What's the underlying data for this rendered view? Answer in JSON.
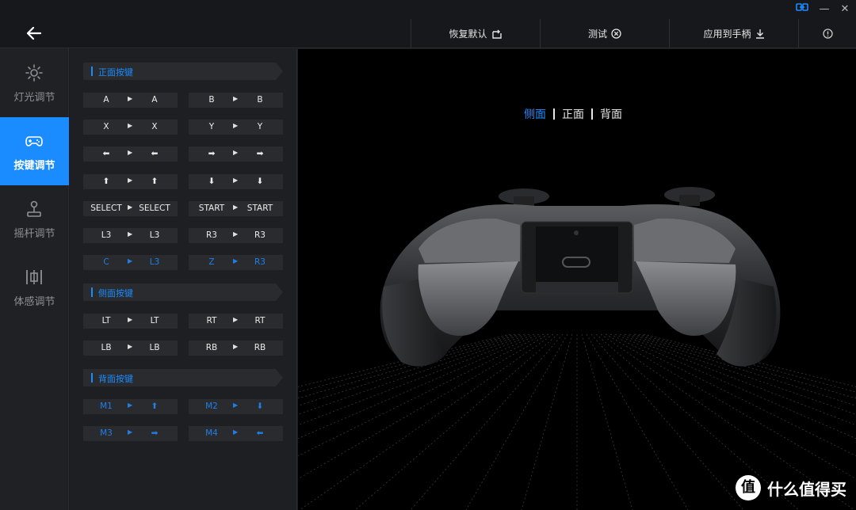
{
  "window": {
    "link_icon": "link-icon",
    "minimize": "—",
    "close": "✕"
  },
  "nav": {
    "back_icon": "arrow-left-icon",
    "items": [
      {
        "label": "灯光调节",
        "icon": "sun-icon",
        "active": false
      },
      {
        "label": "按键调节",
        "icon": "gamepad-icon",
        "active": true
      },
      {
        "label": "摇杆调节",
        "icon": "joystick-icon",
        "active": false
      },
      {
        "label": "体感调节",
        "icon": "motion-icon",
        "active": false
      }
    ]
  },
  "toolbar": {
    "restore": "恢复默认",
    "test": "测试",
    "apply": "应用到手柄",
    "info_icon": "info-icon"
  },
  "sections": {
    "front": "正面按键",
    "side": "侧面按键",
    "back": "背面按键"
  },
  "mappings": {
    "front": [
      {
        "from": "A",
        "to": "A",
        "blue": false
      },
      {
        "from": "B",
        "to": "B",
        "blue": false
      },
      {
        "from": "X",
        "to": "X",
        "blue": false
      },
      {
        "from": "Y",
        "to": "Y",
        "blue": false
      },
      {
        "from": "⬅",
        "to": "⬅",
        "blue": false
      },
      {
        "from": "➡",
        "to": "➡",
        "blue": false
      },
      {
        "from": "⬆",
        "to": "⬆",
        "blue": false
      },
      {
        "from": "⬇",
        "to": "⬇",
        "blue": false
      },
      {
        "from": "SELECT",
        "to": "SELECT",
        "blue": false
      },
      {
        "from": "START",
        "to": "START",
        "blue": false
      },
      {
        "from": "L3",
        "to": "L3",
        "blue": false
      },
      {
        "from": "R3",
        "to": "R3",
        "blue": false
      },
      {
        "from": "C",
        "to": "L3",
        "blue": true
      },
      {
        "from": "Z",
        "to": "R3",
        "blue": true
      }
    ],
    "side": [
      {
        "from": "LT",
        "to": "LT",
        "blue": false
      },
      {
        "from": "RT",
        "to": "RT",
        "blue": false
      },
      {
        "from": "LB",
        "to": "LB",
        "blue": false
      },
      {
        "from": "RB",
        "to": "RB",
        "blue": false
      }
    ],
    "back": [
      {
        "from": "M1",
        "to": "⬆",
        "blue": true
      },
      {
        "from": "M2",
        "to": "⬇",
        "blue": true
      },
      {
        "from": "M3",
        "to": "➡",
        "blue": true
      },
      {
        "from": "M4",
        "to": "⬅",
        "blue": true
      }
    ]
  },
  "view_tabs": {
    "side": "侧面",
    "front": "正面",
    "back": "背面",
    "active": "side"
  },
  "watermark": {
    "logo": "值",
    "text": "什么值得买"
  },
  "colors": {
    "accent": "#1a8cff",
    "background": "#1b1c1f",
    "viewer": "#000000"
  }
}
